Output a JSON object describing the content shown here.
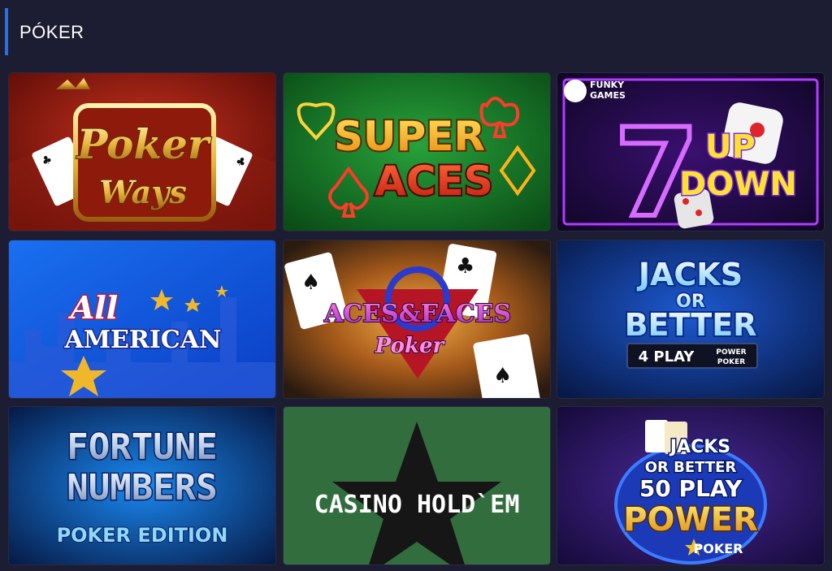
{
  "section": {
    "title": "PÓKER"
  },
  "games": [
    {
      "id": "poker-ways",
      "line1": "Poker",
      "line2": "Ways"
    },
    {
      "id": "super-aces",
      "line1": "SUPER",
      "line2": "ACES"
    },
    {
      "id": "7-up-down",
      "brand1": "FUNKY",
      "brand2": "GAMES",
      "num": "7",
      "line1": "UP",
      "line2": "DOWN"
    },
    {
      "id": "all-american",
      "line1": "All",
      "line2": "AMERICAN"
    },
    {
      "id": "aces-faces",
      "line1": "ACES&FACES",
      "line2": "Poker"
    },
    {
      "id": "jacks-better-4",
      "line1": "JACKS",
      "line2": "OR",
      "line3": "BETTER",
      "badge": "4 PLAY",
      "badge_sub1": "POWER",
      "badge_sub2": "POKER"
    },
    {
      "id": "fortune-numbers",
      "line1": "FORTUNE",
      "line2": "NUMBERS",
      "line3": "POKER EDITION"
    },
    {
      "id": "casino-holdem",
      "line1": "CASINO HOLD`EM"
    },
    {
      "id": "jacks-better-50",
      "line1": "JACKS",
      "line2": "OR BETTER",
      "line3": "50 PLAY",
      "line4": "POWER",
      "line5": "POKER"
    }
  ],
  "colors": {
    "background": "#1c1d33",
    "accent": "#2f6fdc"
  }
}
